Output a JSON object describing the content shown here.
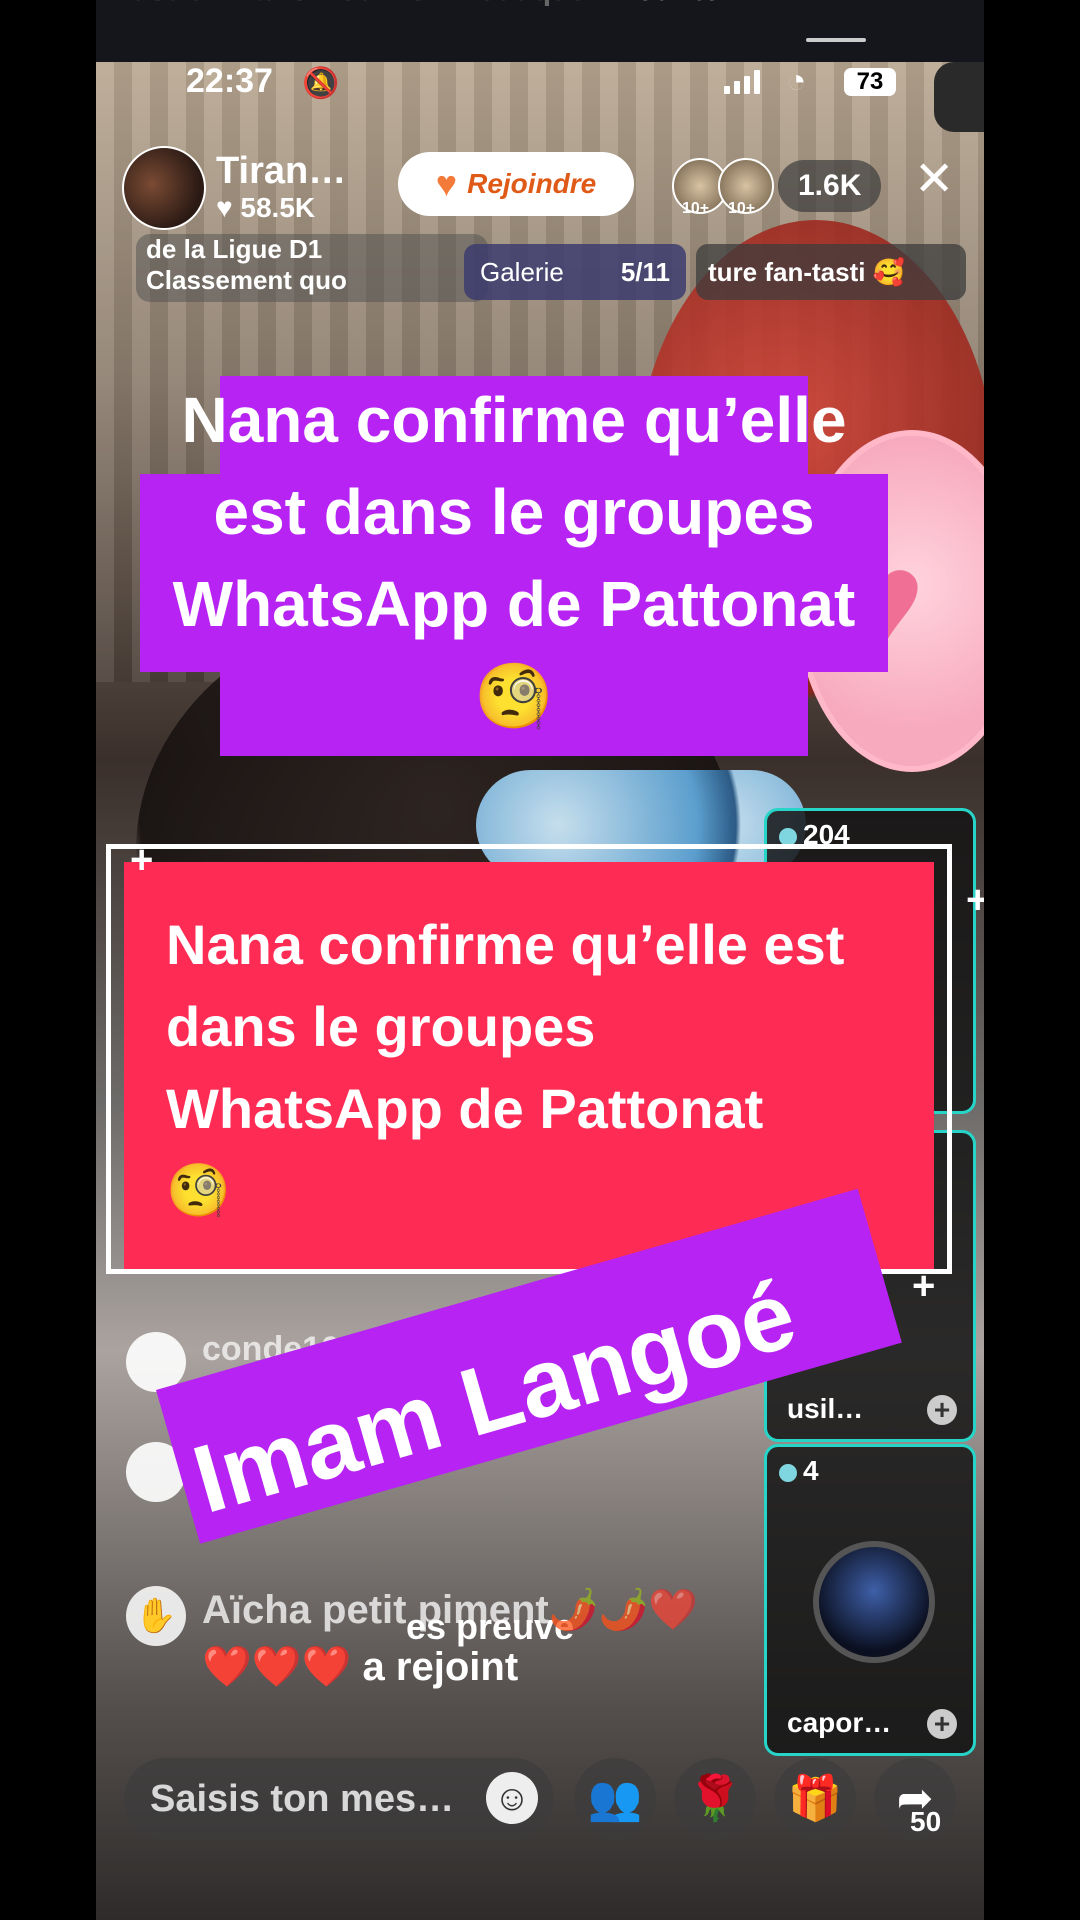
{
  "top_tabs": [
    "illustré",
    "Paris",
    "Suivis",
    "Boutique",
    "Pour toi"
  ],
  "status": {
    "time": "22:37",
    "battery": "73"
  },
  "host": {
    "name": "Tiran…",
    "likes": "58.5K",
    "join_label": "Rejoindre"
  },
  "viewers": {
    "badge1": "10+",
    "badge2": "10+",
    "count": "1.6K"
  },
  "ticker": [
    "de la Ligue D1",
    "Classement quo"
  ],
  "galerie": {
    "label": "Galerie",
    "page": "5/11"
  },
  "fan_pill": "ture fan-tasti",
  "caption_purple": "Nana confirme qu’elle est dans le groupes WhatsApp de Pattonat 🧐",
  "caption_red": "Nana confirme qu’elle est dans le groupes WhatsApp de Pattonat",
  "caption_red_emoji": "🧐",
  "side_cards": [
    {
      "count": "204",
      "name": ""
    },
    {
      "count": "",
      "name": "usil…"
    },
    {
      "count": "4",
      "name": "capor…"
    }
  ],
  "chat": [
    {
      "user": "conde1005",
      "message": "😂😂😂😂"
    },
    {
      "user": "",
      "message": "es preuve"
    }
  ],
  "joined": {
    "name": "Aïcha petit piment🌶️🌶️❤️",
    "hearts": "❤️❤️❤️",
    "action": "a rejoint"
  },
  "banner": "Imam Langoé",
  "input": {
    "placeholder": "Saisis ton mes…"
  },
  "share_count": "50",
  "colors": {
    "accent_purple": "#b623f2",
    "accent_red": "#fe2c55",
    "teal": "#27d5c8",
    "join_orange": "#e05a17"
  }
}
